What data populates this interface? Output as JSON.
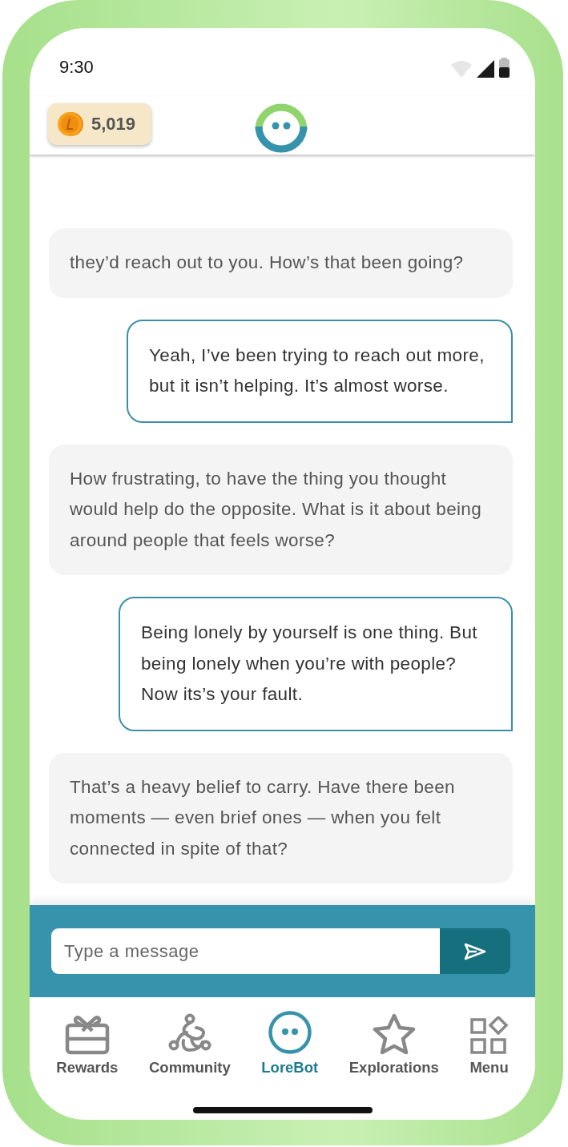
{
  "status_bar": {
    "time": "9:30"
  },
  "header": {
    "coins": "5,019"
  },
  "messages": [
    {
      "kind": "bot",
      "text": "they’d reach out to you. How’s that been going?"
    },
    {
      "kind": "user",
      "text": "Yeah, I’ve been trying to reach out more, but it isn’t helping. It’s almost worse."
    },
    {
      "kind": "bot",
      "text": "How frustrating, to have the thing you thought would help do the opposite. What is it about being around people that feels worse?"
    },
    {
      "kind": "user",
      "text": "Being lonely by yourself is one thing. But being lonely when you’re with people? Now its’s your fault."
    },
    {
      "kind": "bot",
      "text": "That’s a heavy belief to carry. Have there been moments — even brief ones — when you felt connected in spite of that?"
    }
  ],
  "composer": {
    "placeholder": "Type a message"
  },
  "nav": [
    {
      "kind": "gift",
      "label": "Rewards",
      "selected": false
    },
    {
      "kind": "community",
      "label": "Community",
      "selected": false
    },
    {
      "kind": "bot",
      "label": "LoreBot",
      "selected": true
    },
    {
      "kind": "star",
      "label": "Explorations",
      "selected": false
    },
    {
      "kind": "grid",
      "label": "Menu",
      "selected": false
    }
  ]
}
